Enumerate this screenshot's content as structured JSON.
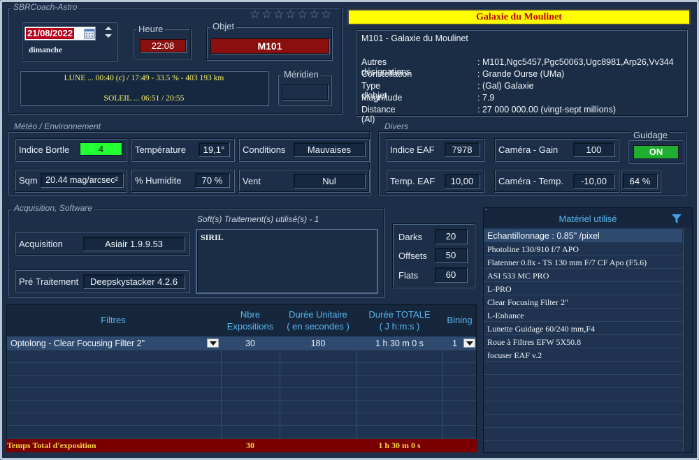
{
  "app": {
    "title": "SBRCoach-Astro"
  },
  "rating": {
    "stars": 0,
    "max": 7
  },
  "session": {
    "date": "21/08/2022",
    "weekday": "dimanche",
    "heure_label": "Heure",
    "heure_value": "22:08",
    "objet_label": "Objet",
    "objet_value": "M101",
    "lune": "LUNE ... 00:40 (c) / 17:49 - 33.5 % - 403 193 km",
    "soleil": "SOLEIL ... 06:51 / 20:55",
    "meridien_label": "Méridien",
    "meridien_value": ""
  },
  "object": {
    "banner": "Galaxie du Moulinet",
    "heading": "M101 - Galaxie du Moulinet",
    "rows": [
      {
        "key": "Autres désignations",
        "value": ": M101,Ngc5457,Pgc50063,Ugc8981,Arp26,Vv344"
      },
      {
        "key": "Constellation",
        "value": ": Grande Ourse (UMa)"
      },
      {
        "key": "Type d'objet",
        "value": ": (Gal) Galaxie"
      },
      {
        "key": "Magnitude",
        "value": ": 7.9"
      },
      {
        "key": "Distance (Al)",
        "value": ": 27 000 000.00 (vingt-sept millions)"
      }
    ]
  },
  "meteo": {
    "title": "Météo / Environnement",
    "bortle_label": "Indice Bortle",
    "bortle_value": "4",
    "temp_label": "Température",
    "temp_value": "19,1°",
    "cond_label": "Conditions",
    "cond_value": "Mauvaises",
    "sqm_label": "Sqm",
    "sqm_value": "20.44 mag/arcsec²",
    "hum_label": "% Humidite",
    "hum_value": "70 %",
    "vent_label": "Vent",
    "vent_value": "Nul"
  },
  "divers": {
    "title": "Divers",
    "eaf_label": "Indice EAF",
    "eaf_value": "7978",
    "gain_label": "Caméra - Gain",
    "gain_value": "100",
    "guidage_label": "Guidage",
    "guidage_value": "ON",
    "teaf_label": "Temp. EAF",
    "teaf_value": "10,00",
    "ctemp_label": "Caméra - Temp.",
    "ctemp_value": "-10,00",
    "ctemp_pct": "64 %"
  },
  "acquisition": {
    "title": "Acquisition, Software",
    "soft_title": "Soft(s) Traitement(s) utilisé(s) - 1",
    "acq_label": "Acquisition",
    "acq_value": "Asiair 1.9.9.53",
    "pre_label": "Pré Traitement",
    "pre_value": "Deepskystacker 4.2.6",
    "soft_value": "SIRIL"
  },
  "calib": {
    "darks_label": "Darks",
    "darks_value": "20",
    "offsets_label": "Offsets",
    "offsets_value": "50",
    "flats_label": "Flats",
    "flats_value": "60"
  },
  "filters_table": {
    "headers": {
      "filtres": "Filtres",
      "nbre1": "Nbre",
      "nbre2": "Expositions",
      "duree1": "Durée Unitaire",
      "duree2": "( en secondes )",
      "total1": "Durée TOTALE",
      "total2": "( J h:m:s )",
      "bining": "Bining"
    },
    "rows": [
      {
        "filtre": "Optolong - Clear Focusing Filter 2\"",
        "nbre": "30",
        "duree": "180",
        "total": "1 h 30 m 0 s",
        "bining": "1"
      }
    ],
    "footer": {
      "label": "Temps Total d'exposition",
      "nbre": "30",
      "total": "1 h 30 m 0 s"
    }
  },
  "materiel": {
    "title": "Matériel utilisé",
    "items": [
      "Echantillonnage : 0.85\" /pixel",
      "Photoline 130/910 f/7 APO",
      "Flatenner 0.8x - TS 130 mm F/7 CF Apo (F5.6)",
      "ASI 533 MC PRO",
      "L-PRO",
      "Clear Focusing Filter 2\"",
      "L-Enhance",
      "Lunette Guidage 60/240 mm,F4",
      "Roue à Filtres EFW 5X50.8",
      "focuser EAF v.2"
    ]
  },
  "colors": {
    "background": "#1d2f48",
    "banner": "#ffff00",
    "red_field": "#8a0f0f",
    "green_on": "#1fae2f",
    "bortle_green": "#22ff33",
    "footer_red": "#7a0000",
    "header_blue": "#59b8f0"
  }
}
